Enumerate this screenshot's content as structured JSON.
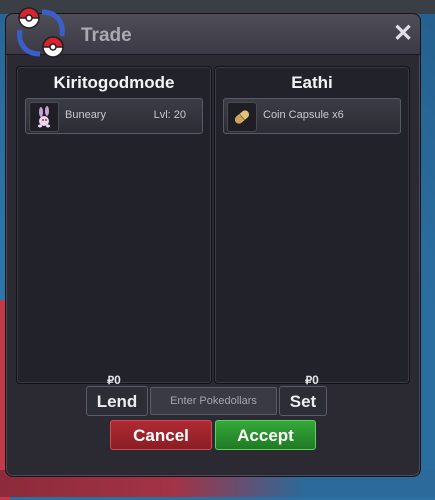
{
  "window": {
    "title": "Trade",
    "close_label": "✕"
  },
  "trade": {
    "left": {
      "player": "Kiritogodmode",
      "item": {
        "name": "Buneary",
        "level": "Lvl: 20",
        "icon": "buneary-icon"
      },
      "money": "0",
      "money_symbol": "₽"
    },
    "right": {
      "player": "Eathi",
      "item": {
        "name": "Coin Capsule  x6",
        "icon": "coin-capsule-icon"
      },
      "money": "0",
      "money_symbol": "₽"
    }
  },
  "controls": {
    "lend_label": "Lend",
    "pokedollars_placeholder": "Enter Pokedollars",
    "set_label": "Set",
    "cancel_label": "Cancel",
    "accept_label": "Accept"
  },
  "colors": {
    "cancel": "#9e2430",
    "accept": "#2d9532",
    "window_bg": "#2b2a33"
  }
}
